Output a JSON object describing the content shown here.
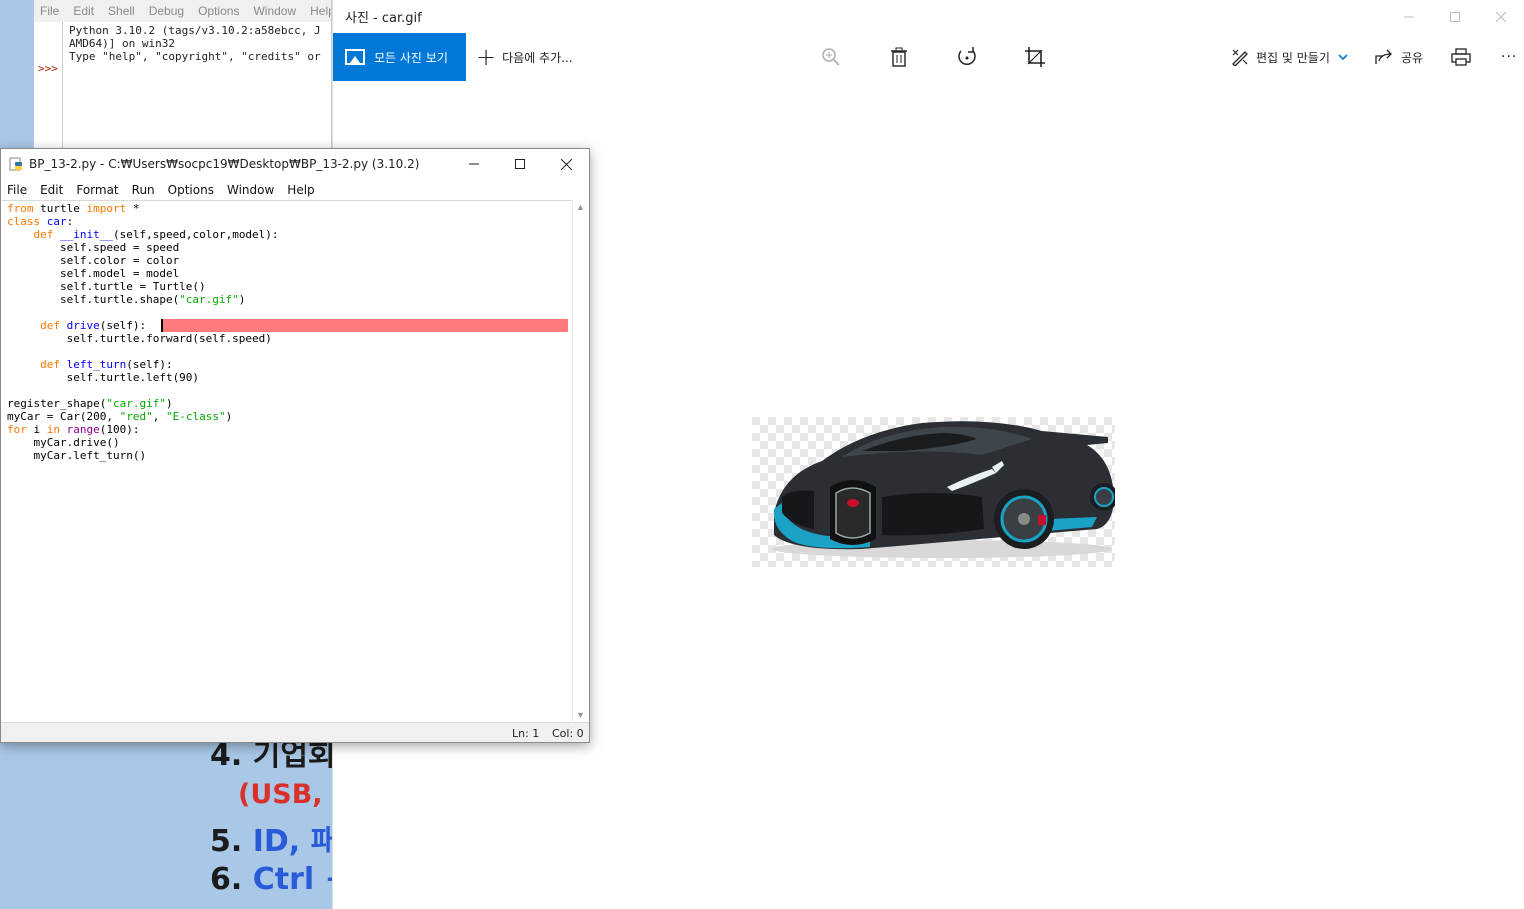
{
  "slide": {
    "line4": "4. 기업회",
    "line4b": "(USB, 외",
    "line5_num": "5. ",
    "line5_text": "ID, 패스",
    "line6_num": "6. ",
    "line6_text": "Ctrl + A"
  },
  "shell": {
    "menu": [
      "File",
      "Edit",
      "Shell",
      "Debug",
      "Options",
      "Window",
      "Help"
    ],
    "output": "Python 3.10.2 (tags/v3.10.2:a58ebcc, J\nAMD64)] on win32\nType \"help\", \"copyright\", \"credits\" or",
    "prompt": ">>>"
  },
  "photos": {
    "title": "사진 - car.gif",
    "all_photos": "모든 사진 보기",
    "add_to": "다음에 추가...",
    "edit_create": "편집 및 만들기",
    "share": "공유",
    "more": "···",
    "icons": [
      "zoom-in-icon",
      "delete-icon",
      "rotate-icon",
      "crop-icon",
      "print-icon"
    ]
  },
  "editor": {
    "title": "BP_13-2.py - C:₩Users₩socpc19₩Desktop₩BP_13-2.py (3.10.2)",
    "menu": [
      "File",
      "Edit",
      "Format",
      "Run",
      "Options",
      "Window",
      "Help"
    ],
    "status_ln": "Ln: 1",
    "status_col": "Col: 0"
  }
}
